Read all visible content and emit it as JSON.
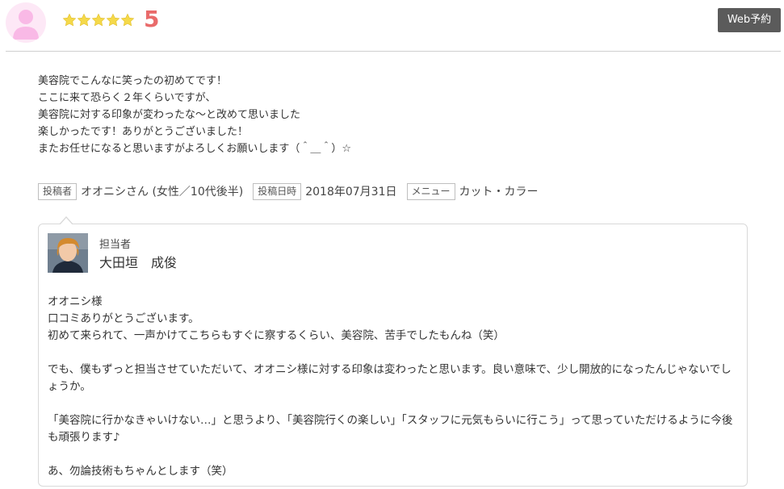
{
  "header": {
    "rating_value": "5",
    "star_count": 5,
    "web_reserve_label": "Web予約",
    "colors": {
      "star": "#f5d94a",
      "rating_number": "#e96b6b",
      "button_bg": "#5b5b5b"
    }
  },
  "review": {
    "lines": [
      "美容院でこんなに笑ったの初めてです！",
      "ここに来て恐らく２年くらいですが、",
      "美容院に対する印象が変わったな〜と改めて思いました",
      "楽しかったです！ありがとうございました！",
      "またお任せになると思いますがよろしくお願いします（＾＿＾）☆"
    ]
  },
  "meta": {
    "poster_label": "投稿者",
    "poster_value": "オオニシさん (女性／10代後半)",
    "date_label": "投稿日時",
    "date_value": "2018年07月31日",
    "menu_label": "メニュー",
    "menu_value": "カット・カラー"
  },
  "reply": {
    "role_label": "担当者",
    "staff_name": "大田垣　成俊",
    "paragraphs": [
      [
        "オオニシ様",
        "口コミありがとうございます。",
        "初めて来られて、一声かけてこちらもすぐに察するくらい、美容院、苦手でしたもんね（笑）"
      ],
      [
        "でも、僕もずっと担当させていただいて、オオニシ様に対する印象は変わったと思います。良い意味で、少し開放的になったんじゃないでしょうか。"
      ],
      [
        "「美容院に行かなきゃいけない…」と思うより、「美容院行くの楽しい」「スタッフに元気もらいに行こう」って思っていただけるように今後も頑張ります♪"
      ],
      [
        "あ、勿論技術もちゃんとします（笑）"
      ]
    ]
  }
}
